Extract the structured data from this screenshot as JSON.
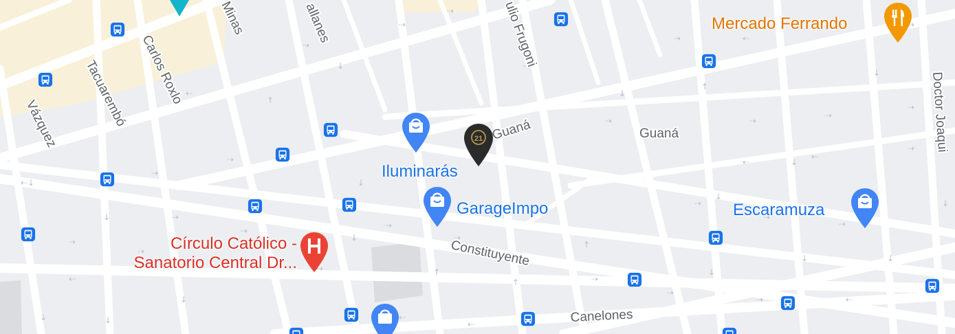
{
  "streets": {
    "vazquez": "Vázquez",
    "tacuarembo": "Tacuarembó",
    "carlos_roxlo": "Carlos Roxlo",
    "minas": "Minas",
    "magallanes": "allanes",
    "frugoni": "ulio Frugoni",
    "guana_1": "Guaná",
    "guana_2": "Guaná",
    "constituyente": "Constituyente",
    "canelones": "Canelones",
    "doctor": "Doctor Joaqui"
  },
  "pois": {
    "mercado": "Mercado Ferrando",
    "iluminaras": "Iluminarás",
    "garageimpo": "GarageImpo",
    "escaramuza": "Escaramuza",
    "circulo_line1": "Círculo Católico -",
    "circulo_line2": "Sanatorio Central Dr..."
  },
  "marker": {
    "badge": "21",
    "icon": "century21-pin-icon"
  },
  "colors": {
    "poi_blue": "#1a73e8",
    "poi_red": "#d93025",
    "poi_orange": "#e37400",
    "hospital_pin": "#ea4335",
    "bus_stop": "#1a73e8"
  }
}
